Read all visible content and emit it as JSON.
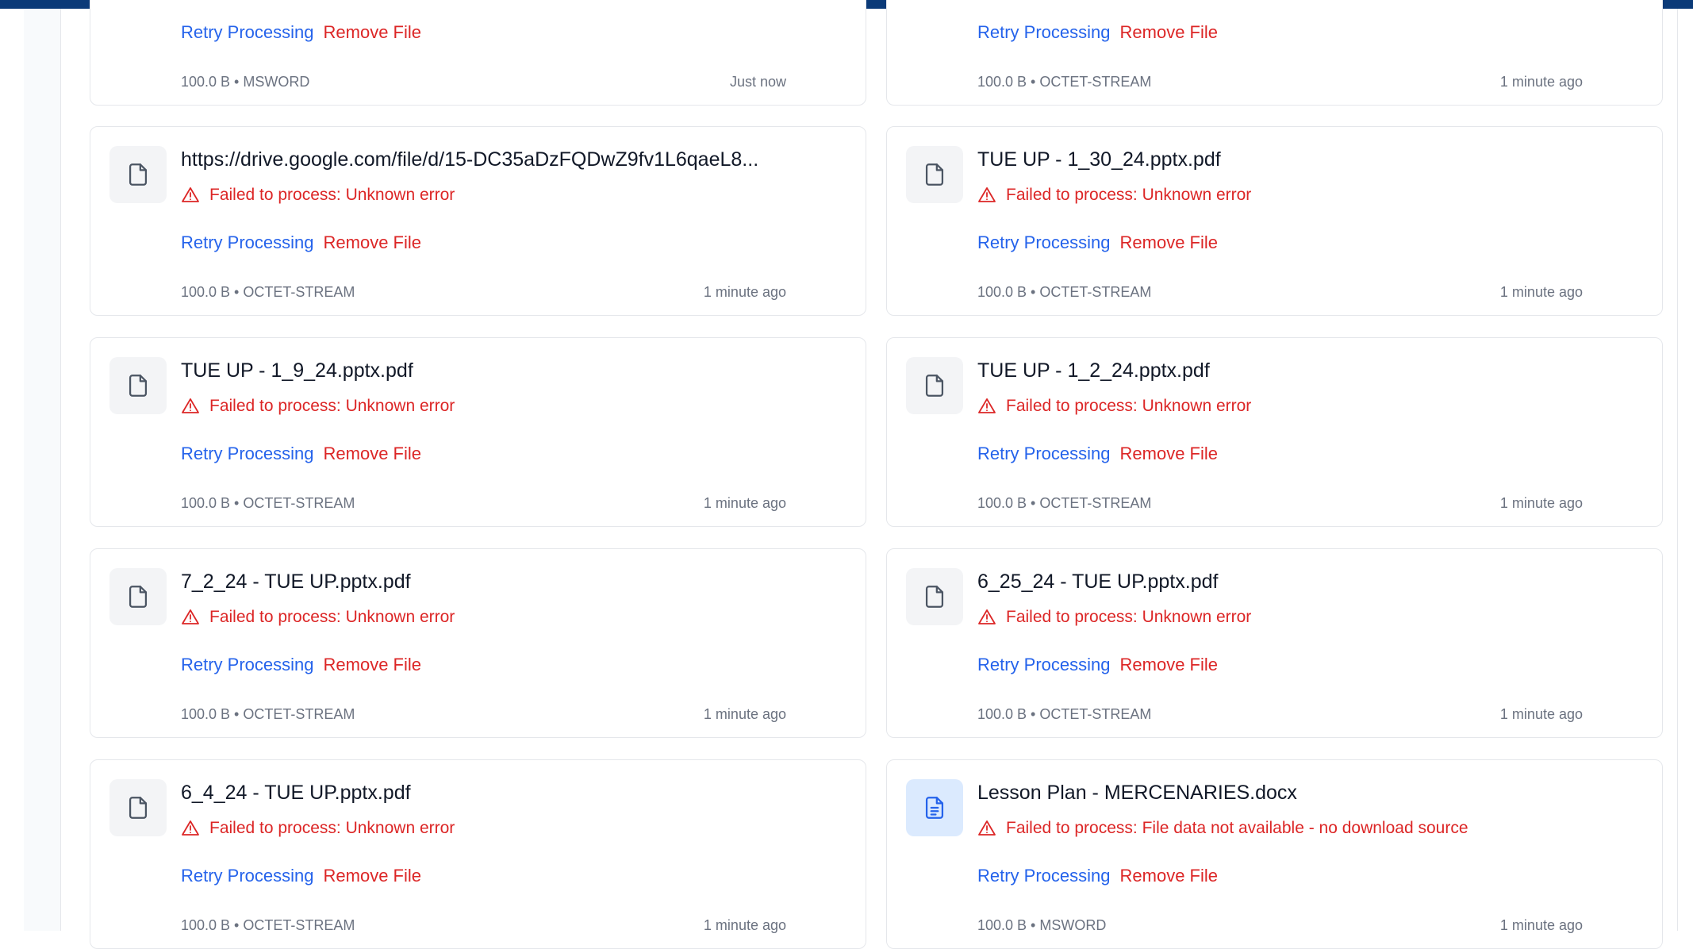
{
  "accent_colors": {
    "topbar": "#0b3a78",
    "link_blue": "#2563eb",
    "error_red": "#dc2626",
    "meta_gray": "#6b7280"
  },
  "actions": {
    "retry_label": "Retry Processing",
    "remove_label": "Remove File"
  },
  "files": [
    {
      "name": "",
      "error": "",
      "meta": "100.0 B • MSWORD",
      "time": "Just now",
      "icon": "document-outline-icon"
    },
    {
      "name": "",
      "error": "",
      "meta": "100.0 B • OCTET-STREAM",
      "time": "1 minute ago",
      "icon": "document-outline-icon"
    },
    {
      "name": "https://drive.google.com/file/d/15-DC35aDzFQDwZ9fv1L6qaeL8...",
      "error": "Failed to process: Unknown error",
      "meta": "100.0 B • OCTET-STREAM",
      "time": "1 minute ago",
      "icon": "document-outline-icon"
    },
    {
      "name": "TUE UP - 1_30_24.pptx.pdf",
      "error": "Failed to process: Unknown error",
      "meta": "100.0 B • OCTET-STREAM",
      "time": "1 minute ago",
      "icon": "document-outline-icon"
    },
    {
      "name": "TUE UP - 1_9_24.pptx.pdf",
      "error": "Failed to process: Unknown error",
      "meta": "100.0 B • OCTET-STREAM",
      "time": "1 minute ago",
      "icon": "document-outline-icon"
    },
    {
      "name": "TUE UP - 1_2_24.pptx.pdf",
      "error": "Failed to process: Unknown error",
      "meta": "100.0 B • OCTET-STREAM",
      "time": "1 minute ago",
      "icon": "document-outline-icon"
    },
    {
      "name": "7_2_24 - TUE UP.pptx.pdf",
      "error": "Failed to process: Unknown error",
      "meta": "100.0 B • OCTET-STREAM",
      "time": "1 minute ago",
      "icon": "document-outline-icon"
    },
    {
      "name": "6_25_24 - TUE UP.pptx.pdf",
      "error": "Failed to process: Unknown error",
      "meta": "100.0 B • OCTET-STREAM",
      "time": "1 minute ago",
      "icon": "document-outline-icon"
    },
    {
      "name": "6_4_24 - TUE UP.pptx.pdf",
      "error": "Failed to process: Unknown error",
      "meta": "100.0 B • OCTET-STREAM",
      "time": "1 minute ago",
      "icon": "document-outline-icon"
    },
    {
      "name": "Lesson Plan - MERCENARIES.docx",
      "error": "Failed to process: File data not available - no download source",
      "meta": "100.0 B • MSWORD",
      "time": "1 minute ago",
      "icon": "document-text-icon"
    }
  ]
}
